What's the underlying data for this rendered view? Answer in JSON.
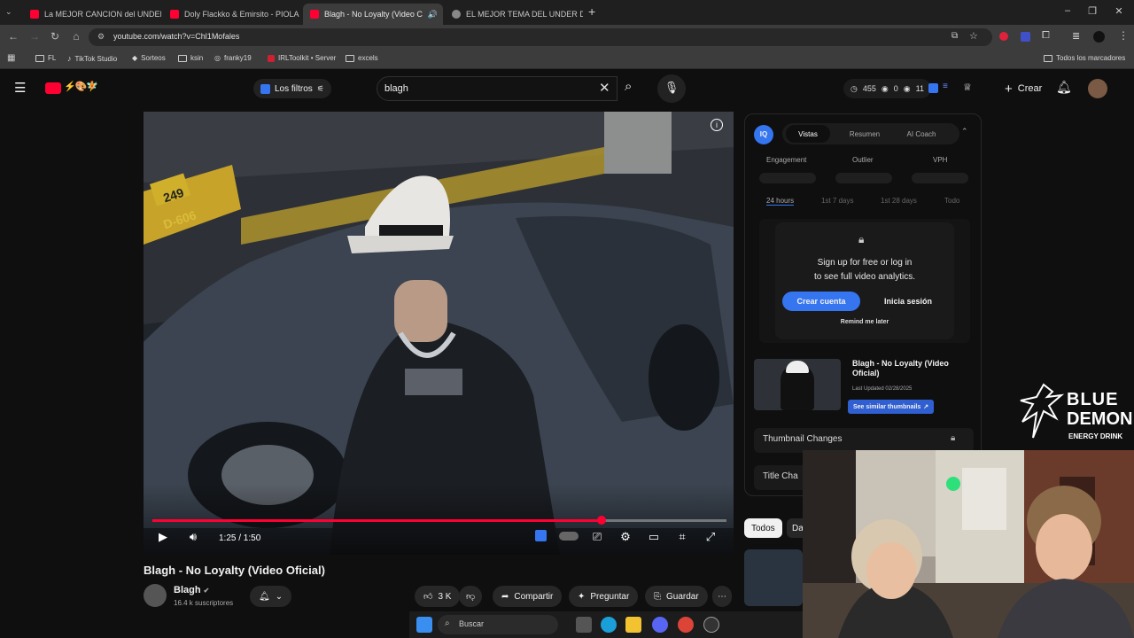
{
  "browser": {
    "tabs": [
      {
        "title": "La MEJOR CANCION del UNDER",
        "active": false
      },
      {
        "title": "Doly Flackko & Emirsito - PIOLA",
        "active": false
      },
      {
        "title": "Blagh - No Loyalty (Video C",
        "active": true
      },
      {
        "title": "EL MEJOR TEMA DEL UNDER D",
        "active": false
      }
    ],
    "url": "youtube.com/watch?v=Chl1Mofales",
    "bookmarks": [
      "FL",
      "TikTok Studio",
      "Sorteos",
      "ksin",
      "franky19",
      "IRLToolkit • Server",
      "excels"
    ],
    "all_bookmarks": "Todos los marcadores"
  },
  "header": {
    "filters_label": "Los filtros",
    "search_value": "blagh",
    "stats": {
      "views": "455",
      "likes": "0",
      "comments": "11"
    },
    "create_label": "Crear"
  },
  "player": {
    "timecode": "1:25 / 1:50",
    "progress": 0.783,
    "plate_number": "249",
    "plate_code": "D-606"
  },
  "video": {
    "title": "Blagh - No Loyalty (Video Oficial)",
    "channel": "Blagh",
    "subscribers": "16.4 k suscriptores",
    "likes": "3 K",
    "share_label": "Compartir",
    "ask_label": "Preguntar",
    "save_label": "Guardar"
  },
  "iq_panel": {
    "logo": "IQ",
    "tabs": [
      "Vistas",
      "Resumen",
      "AI Coach"
    ],
    "metrics": [
      "Engagement",
      "Outlier",
      "VPH"
    ],
    "ranges": [
      "24 hours",
      "1st 7 days",
      "1st 28 days",
      "Todo"
    ],
    "signup_line1": "Sign up for free or log in",
    "signup_line2": "to see full video analytics.",
    "create_account": "Crear cuenta",
    "login": "Inicia sesión",
    "remind": "Remind me later",
    "thumb_title": "Blagh - No Loyalty (Video Oficial)",
    "last_updated": "Last Updated 02/28/2025",
    "similar_label": "See similar thumbnails",
    "thumbnail_changes": "Thumbnail Changes",
    "title_changes": "Title Cha"
  },
  "chips": {
    "first": "Todos",
    "second": "Da"
  },
  "overlay_logo": {
    "line1": "BLUE",
    "line2": "DEMON",
    "line3": "ENERGY DRINK"
  },
  "taskbar": {
    "search_label": "Buscar"
  },
  "colors": {
    "accent": "#ff0033",
    "iq_blue": "#3575f0"
  }
}
